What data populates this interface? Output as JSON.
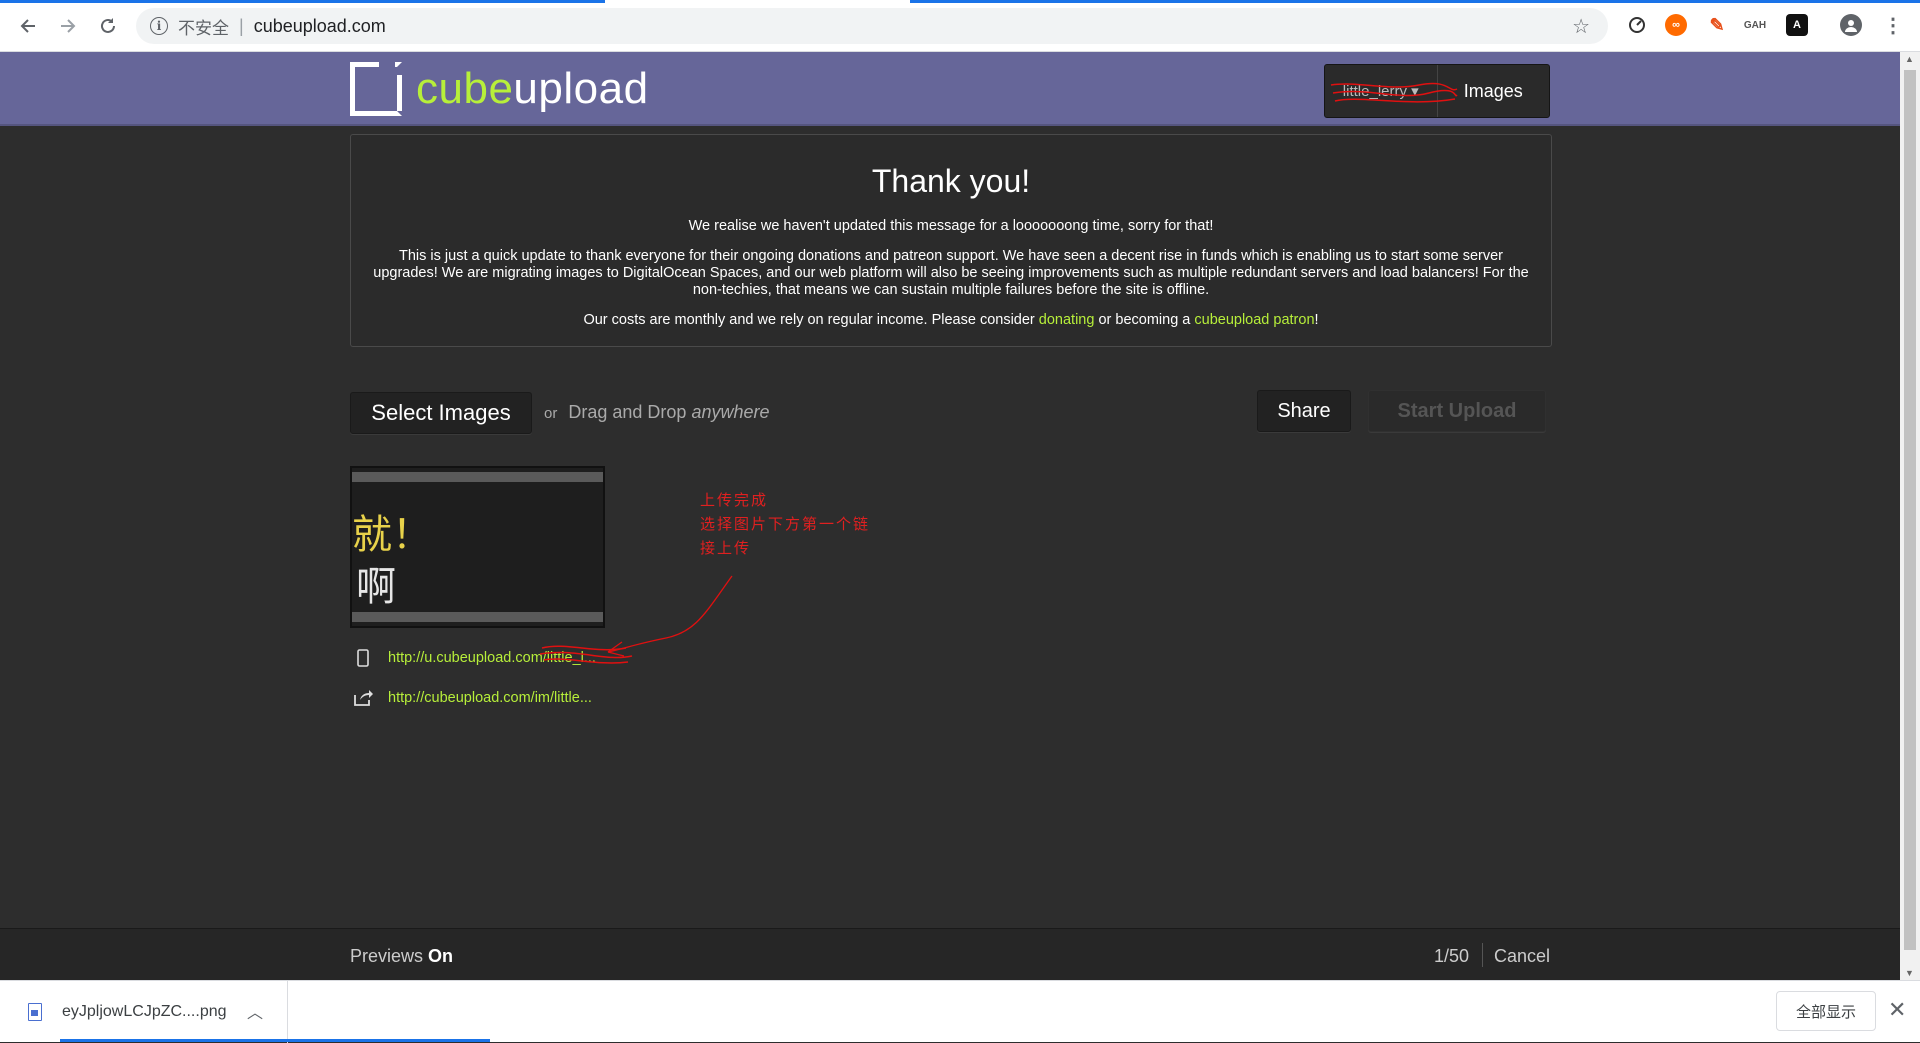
{
  "browser": {
    "security_label": "不安全",
    "separator": "|",
    "url": "cubeupload.com",
    "ext_labels": [
      "GAH"
    ]
  },
  "site": {
    "logo_part1": "cube",
    "logo_part2": "upload",
    "user_menu_label": "little_lerry ▾",
    "images_label": "Images"
  },
  "notice": {
    "title": "Thank you!",
    "line1": "We realise we haven't updated this message for a looooooong time, sorry for that!",
    "line2": "This is just a quick update to thank everyone for their ongoing donations and patreon support. We have seen a decent rise in funds which is enabling us to start some server upgrades! We are migrating images to DigitalOcean Spaces, and our web platform will also be seeing improvements such as multiple redundant servers and load balancers! For the non-techies, that means we can sustain multiple failures before the site is offline.",
    "line3_pre": "Our costs are monthly and we rely on regular income. Please consider ",
    "donate_link": "donating",
    "line3_mid": " or becoming a ",
    "patron_link": "cubeupload patron",
    "line3_post": "!"
  },
  "toolbar": {
    "select_label": "Select Images",
    "or_label": "or",
    "drag_label": "Drag and Drop ",
    "anywhere_label": "anywhere",
    "share_label": "Share",
    "start_label": "Start Upload"
  },
  "preview": {
    "text_line1": "就！",
    "text_line2": "啊",
    "direct_link": "http://u.cubeupload.com/little_l...",
    "page_link": "http://cubeupload.com/im/little..."
  },
  "annotation": {
    "line1": "上传完成",
    "line2": "选择图片下方第一个链",
    "line3": "接上传"
  },
  "footer": {
    "previews_label": "Previews ",
    "previews_state": "On",
    "count": "1/50",
    "cancel_label": "Cancel"
  },
  "downloads": {
    "filename": "eyJpljowLCJpZC....png",
    "show_all_label": "全部显示"
  },
  "colors": {
    "accent_green": "#b7ef3a",
    "header_purple": "#666699",
    "annotation_red": "#e02020"
  }
}
